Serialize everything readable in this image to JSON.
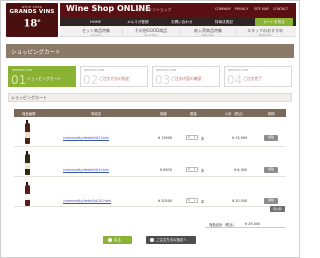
{
  "header": {
    "logo": {
      "line1": "wine shop",
      "line2": "GRANDS VINS",
      "line3": "18",
      "line3_sup": "e"
    },
    "title": "Wine Shop ONLINE",
    "subtitle": "オンラインショップ",
    "utility_links": [
      "COMPANY",
      "PRIVACY",
      "SITE MAP",
      "CONTACT"
    ],
    "nav": [
      "HOME",
      "メルマガ登録",
      "お問い合わせ",
      "特商法表記"
    ],
    "cart_button": "カートを見る",
    "sub_nav": [
      {
        "label": "セット商品特集",
        "en": "Set Item"
      },
      {
        "label": "その他GOOD商品",
        "en": "Good Item"
      },
      {
        "label": "新入荷商品特集",
        "en": "New Item"
      },
      {
        "label": "スタッフのおすすめ",
        "en": "Staff Item"
      }
    ]
  },
  "page_title": "ショッピングカート",
  "steps": [
    {
      "tag": "REGISTER STEP",
      "num": "01",
      "label": "ショッピングカート",
      "active": true
    },
    {
      "tag": "REGISTER STEP",
      "num": "02",
      "label": "ご注文方法の指定",
      "active": false
    },
    {
      "tag": "REGISTER STEP",
      "num": "03",
      "label": "ご注文内容の確認",
      "active": false
    },
    {
      "tag": "REGISTER STEP",
      "num": "04",
      "label": "ご注文完了",
      "active": false
    }
  ],
  "section_title": "ショッピングカート",
  "table": {
    "headers": [
      "商品画像",
      "商品名",
      "価格",
      "数量",
      "小計（税込）",
      "削除"
    ],
    "rows": [
      {
        "name": "/commodity/detail/id/2.html",
        "price": "¥ 13900",
        "qty": "1",
        "unit": "本",
        "subtotal": "¥ 13,900",
        "delete": "削除"
      },
      {
        "name": "/commodity/detail/id/4.html",
        "price": "¥ 6300",
        "qty": "1",
        "unit": "本",
        "subtotal": "¥ 6,300",
        "delete": "削除"
      },
      {
        "name": "/commodity/detail/id/10.html",
        "price": "¥ 20500",
        "qty": "1",
        "unit": "本",
        "subtotal": "¥ 20,500",
        "delete": "削除"
      }
    ]
  },
  "recalc_button": "再計算",
  "total": {
    "label": "商品合計（税込）",
    "value": "¥ 29,400"
  },
  "buttons": {
    "back": "戻る",
    "next": "ご注文方法の指定へ"
  },
  "colors": {
    "brand": "#5a0f12",
    "accent": "#8ab233",
    "band": "#8c7a68",
    "table_head": "#7a6a5a"
  }
}
